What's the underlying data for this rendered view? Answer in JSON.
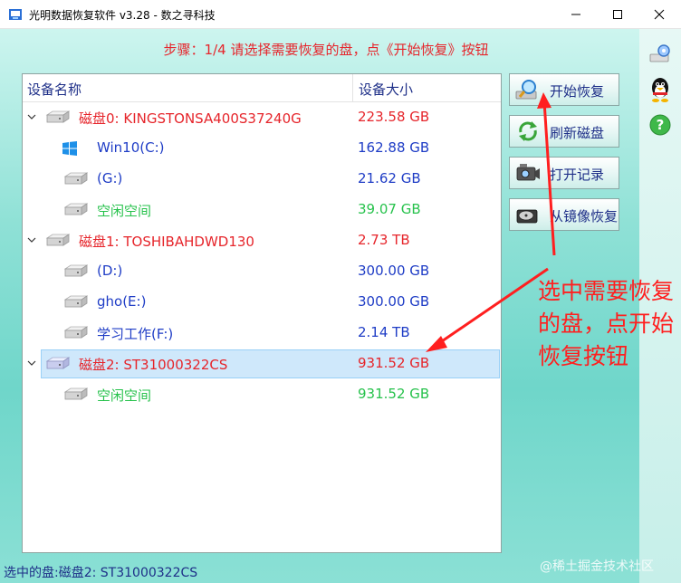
{
  "window": {
    "title": "光明数据恢复软件 v3.28 - 数之寻科技"
  },
  "instruction": "步骤：1/4 请选择需要恢复的盘，点《开始恢复》按钮",
  "tree": {
    "headers": {
      "name": "设备名称",
      "size": "设备大小"
    },
    "rows": [
      {
        "label": "磁盘0: KINGSTONSA400S37240G",
        "size": "223.58 GB",
        "color": "#e6252b"
      },
      {
        "label": "Win10(C:)",
        "size": "162.88 GB",
        "color": "#1f3dc6"
      },
      {
        "label": "(G:)",
        "size": "21.62 GB",
        "color": "#1f3dc6"
      },
      {
        "label": "空闲空间",
        "size": "39.07 GB",
        "color": "#27c24c"
      },
      {
        "label": "磁盘1: TOSHIBAHDWD130",
        "size": "2.73 TB",
        "color": "#e6252b"
      },
      {
        "label": "(D:)",
        "size": "300.00 GB",
        "color": "#1f3dc6"
      },
      {
        "label": "gho(E:)",
        "size": "300.00 GB",
        "color": "#1f3dc6"
      },
      {
        "label": "学习工作(F:)",
        "size": "2.14 TB",
        "color": "#1f3dc6"
      },
      {
        "label": "磁盘2: ST31000322CS",
        "size": "931.52 GB",
        "color": "#e6252b"
      },
      {
        "label": "空闲空间",
        "size": "931.52 GB",
        "color": "#27c24c"
      }
    ]
  },
  "buttons": {
    "start": "开始恢复",
    "refresh": "刷新磁盘",
    "open_record": "打开记录",
    "from_image": "从镜像恢复"
  },
  "annotation": "选中需要恢复的盘，点开始恢复按钮",
  "status": "选中的盘:磁盘2: ST31000322CS",
  "watermark": "@稀土掘金技术社区",
  "colors": {
    "disk": "#e6252b",
    "partition": "#1f3dc6",
    "free": "#27c24c",
    "accent": "#ff1f1f"
  }
}
